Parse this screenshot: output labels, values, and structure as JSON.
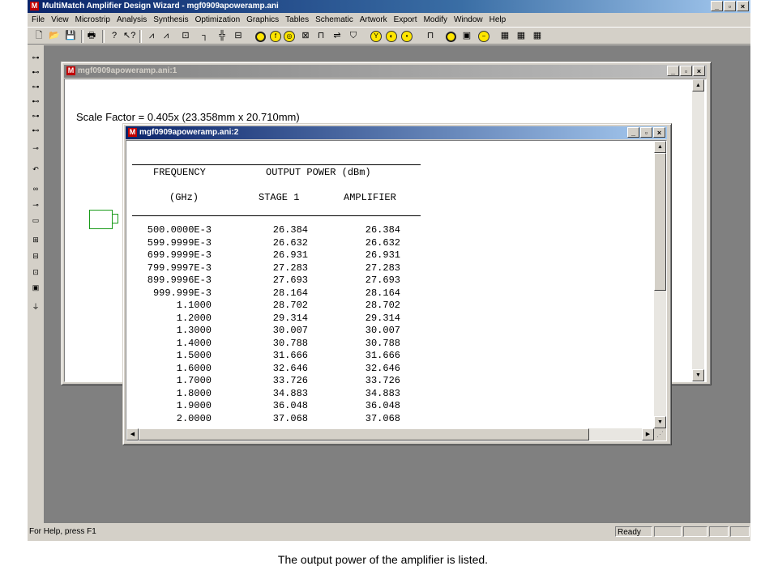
{
  "app": {
    "title": "MultiMatch Amplifier Design Wizard - mgf0909apoweramp.ani",
    "logo": "M",
    "controls": {
      "minimize": "_",
      "restore": "▫",
      "close": "×"
    }
  },
  "menu": [
    "File",
    "View",
    "Microstrip",
    "Analysis",
    "Synthesis",
    "Optimization",
    "Graphics",
    "Tables",
    "Schematic",
    "Artwork",
    "Export",
    "Modify",
    "Window",
    "Help"
  ],
  "statusbar": {
    "help": "For Help, press F1",
    "ready": "Ready"
  },
  "window1": {
    "title": "mgf0909apoweramp.ani:1",
    "scale_label": "Scale Factor =",
    "scale_value": "0.405x (23.358mm x 20.710mm)"
  },
  "window2": {
    "title": "mgf0909apoweramp.ani:2",
    "headers": {
      "col1_line1": "FREQUENCY",
      "col2_line1": "OUTPUT POWER (dBm)",
      "col1_line2": "(GHz)",
      "col2_line2": "STAGE 1",
      "col3_line2": "AMPLIFIER"
    },
    "rows": [
      [
        "500.0000E-3",
        "26.384",
        "26.384"
      ],
      [
        "599.9999E-3",
        "26.632",
        "26.632"
      ],
      [
        "699.9999E-3",
        "26.931",
        "26.931"
      ],
      [
        "799.9997E-3",
        "27.283",
        "27.283"
      ],
      [
        "899.9996E-3",
        "27.693",
        "27.693"
      ],
      [
        "999.999E-3",
        "28.164",
        "28.164"
      ],
      [
        "1.1000",
        "28.702",
        "28.702"
      ],
      [
        "1.2000",
        "29.314",
        "29.314"
      ],
      [
        "1.3000",
        "30.007",
        "30.007"
      ],
      [
        "1.4000",
        "30.788",
        "30.788"
      ],
      [
        "1.5000",
        "31.666",
        "31.666"
      ],
      [
        "1.6000",
        "32.646",
        "32.646"
      ],
      [
        "1.7000",
        "33.726",
        "33.726"
      ],
      [
        "1.8000",
        "34.883",
        "34.883"
      ],
      [
        "1.9000",
        "36.048",
        "36.048"
      ],
      [
        "2.0000",
        "37.068",
        "37.068"
      ]
    ]
  },
  "caption": "The output power of the amplifier is listed."
}
